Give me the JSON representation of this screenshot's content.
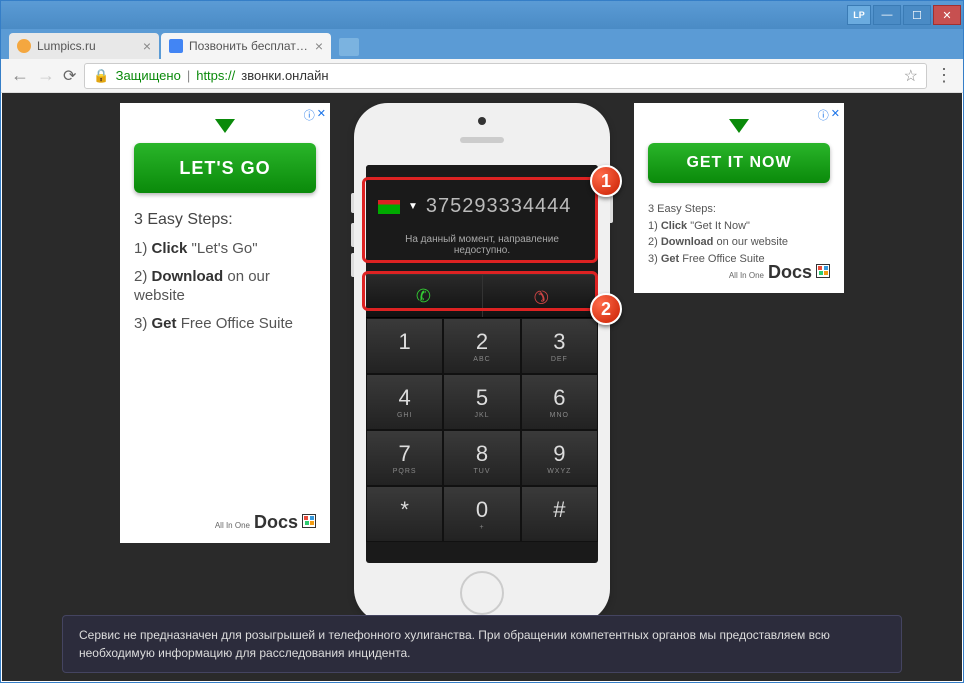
{
  "window": {
    "lp_label": "LP",
    "min": "—",
    "max": "☐",
    "close": "✕"
  },
  "tabs": [
    {
      "title": "Lumpics.ru",
      "favicon": "orange",
      "active": false
    },
    {
      "title": "Позвонить бесплатно д…",
      "favicon": "blue",
      "active": true
    }
  ],
  "addr": {
    "secure_label": "Защищено",
    "protocol": "https://",
    "host": "звонки.онлайн"
  },
  "ad_left": {
    "button": "LET'S GO",
    "steps_title": "3 Easy Steps:",
    "step1_pre": "1) ",
    "step1_b": "Click",
    "step1_post": " \"Let's Go\"",
    "step2_pre": "2) ",
    "step2_b": "Download",
    "step2_post": " on our website",
    "step3_pre": "3) ",
    "step3_b": "Get",
    "step3_post": " Free Office Suite",
    "logo_small": "All In One",
    "logo_big": "Docs"
  },
  "ad_right": {
    "button": "GET IT NOW",
    "steps_title": "3 Easy Steps:",
    "step1_pre": "1) ",
    "step1_b": "Click",
    "step1_post": " \"Get It Now\"",
    "step2_pre": "2) ",
    "step2_b": "Download",
    "step2_post": " on our website",
    "step3_pre": "3) ",
    "step3_b": "Get",
    "step3_post": " Free Office Suite",
    "logo_small": "All In One",
    "logo_big": "Docs"
  },
  "ad_marker": {
    "info": "ⓘ",
    "close": "✕"
  },
  "phone": {
    "number": "375293334444",
    "status": "На данный момент, направление недоступно.",
    "keys": [
      {
        "n": "1",
        "s": ""
      },
      {
        "n": "2",
        "s": "ABC"
      },
      {
        "n": "3",
        "s": "DEF"
      },
      {
        "n": "4",
        "s": "GHI"
      },
      {
        "n": "5",
        "s": "JKL"
      },
      {
        "n": "6",
        "s": "MNO"
      },
      {
        "n": "7",
        "s": "PQRS"
      },
      {
        "n": "8",
        "s": "TUV"
      },
      {
        "n": "9",
        "s": "WXYZ"
      },
      {
        "n": "*",
        "s": ""
      },
      {
        "n": "0",
        "s": "+"
      },
      {
        "n": "#",
        "s": ""
      }
    ]
  },
  "badges": {
    "one": "1",
    "two": "2"
  },
  "disclaimer": "Сервис не предназначен для розыгрышей и телефонного хулиганства. При обращении компетентных органов мы предоставляем всю необходимую информацию для расследования инцидента."
}
